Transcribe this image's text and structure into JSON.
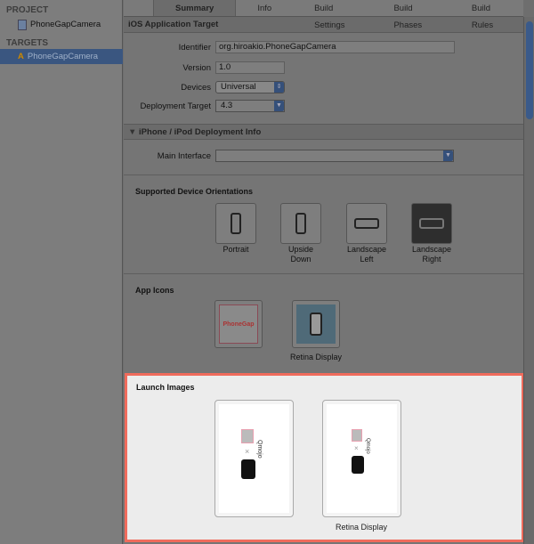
{
  "sidebar": {
    "project_header": "PROJECT",
    "project_item": "PhoneGapCamera",
    "targets_header": "TARGETS",
    "target_item": "PhoneGapCamera"
  },
  "tabs": [
    "Summary",
    "Info",
    "Build Settings",
    "Build Phases",
    "Build Rules"
  ],
  "active_tab": "Summary",
  "ios_target": {
    "title": "iOS Application Target",
    "identifier_label": "Identifier",
    "identifier": "org.hiroakio.PhoneGapCamera",
    "version_label": "Version",
    "version": "1.0",
    "devices_label": "Devices",
    "devices": "Universal",
    "deployment_label": "Deployment Target",
    "deployment": "4.3"
  },
  "iphone_info": {
    "title": "iPhone / iPod Deployment Info",
    "main_interface_label": "Main Interface",
    "main_interface": ""
  },
  "orientations": {
    "title": "Supported Device Orientations",
    "items": [
      {
        "label1": "Portrait",
        "label2": "",
        "selected": false
      },
      {
        "label1": "Upside",
        "label2": "Down",
        "selected": false
      },
      {
        "label1": "Landscape",
        "label2": "Left",
        "selected": false
      },
      {
        "label1": "Landscape",
        "label2": "Right",
        "selected": true
      }
    ]
  },
  "app_icons": {
    "title": "App Icons",
    "retina_label": "Retina Display",
    "icon_text": "PhoneGap"
  },
  "launch_images": {
    "title": "Launch Images",
    "retina_label": "Retina Display",
    "image_text": "Qmojo"
  },
  "colors": {
    "highlight_border": "#ef6b5c",
    "selection": "#3a5680"
  }
}
